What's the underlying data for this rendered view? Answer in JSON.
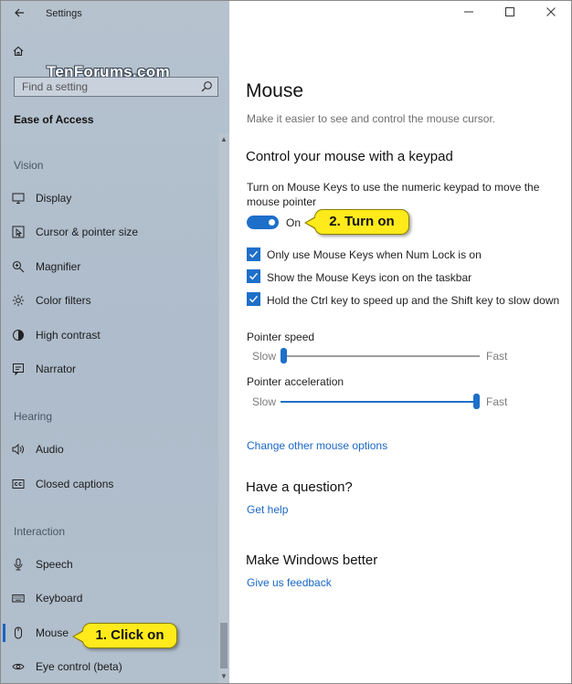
{
  "window": {
    "title": "Settings"
  },
  "watermark": "TenForums.com",
  "search": {
    "placeholder": "Find a setting"
  },
  "sidebar": {
    "section_title": "Ease of Access",
    "groups": {
      "vision": "Vision",
      "hearing": "Hearing",
      "interaction": "Interaction"
    },
    "items": [
      {
        "label": "Display",
        "icon": "display-icon"
      },
      {
        "label": "Cursor & pointer size",
        "icon": "cursor-icon"
      },
      {
        "label": "Magnifier",
        "icon": "magnifier-icon"
      },
      {
        "label": "Color filters",
        "icon": "color-filters-icon"
      },
      {
        "label": "High contrast",
        "icon": "high-contrast-icon"
      },
      {
        "label": "Narrator",
        "icon": "narrator-icon"
      },
      {
        "label": "Audio",
        "icon": "audio-icon"
      },
      {
        "label": "Closed captions",
        "icon": "closed-captions-icon"
      },
      {
        "label": "Speech",
        "icon": "microphone-icon"
      },
      {
        "label": "Keyboard",
        "icon": "keyboard-icon"
      },
      {
        "label": "Mouse",
        "icon": "mouse-icon",
        "active": true
      },
      {
        "label": "Eye control (beta)",
        "icon": "eye-icon"
      }
    ]
  },
  "main": {
    "title": "Mouse",
    "description": "Make it easier to see and control the mouse cursor.",
    "keypad_heading": "Control your mouse with a keypad",
    "keypad_text": "Turn on Mouse Keys to use the numeric keypad to move the mouse pointer",
    "toggle": {
      "state_label": "On",
      "on": true
    },
    "checkboxes": [
      {
        "label": "Only use Mouse Keys when Num Lock is on",
        "checked": true
      },
      {
        "label": "Show the Mouse Keys icon on the taskbar",
        "checked": true
      },
      {
        "label": "Hold the Ctrl key to speed up and the Shift key to slow down",
        "checked": true
      }
    ],
    "pointer_speed": {
      "label": "Pointer speed",
      "min_label": "Slow",
      "max_label": "Fast",
      "value_fraction": 0.0
    },
    "pointer_acceleration": {
      "label": "Pointer acceleration",
      "min_label": "Slow",
      "max_label": "Fast",
      "value_fraction": 1.0
    },
    "other_options_link": "Change other mouse options",
    "question_heading": "Have a question?",
    "help_link": "Get help",
    "better_heading": "Make Windows better",
    "feedback_link": "Give us feedback"
  },
  "callouts": {
    "click_on": "1. Click on",
    "turn_on": "2. Turn on"
  },
  "colors": {
    "accent": "#1d6fc9",
    "callout": "#ffea1c",
    "link": "#1a67c5"
  }
}
